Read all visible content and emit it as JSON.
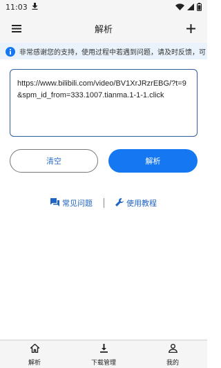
{
  "status_bar": {
    "time": "11:03"
  },
  "app_bar": {
    "title": "解析"
  },
  "notice": {
    "text": "非常感谢您的支持，使用过程中若遇到问题，请及时反馈，可"
  },
  "url_input": {
    "value": "https://www.bilibili.com/video/BV1XrJRzrEBG/?t=9&spm_id_from=333.1007.tianma.1-1-1.click"
  },
  "buttons": {
    "clear_label": "清空",
    "parse_label": "解析"
  },
  "links": {
    "faq_label": "常见问题",
    "tutorial_label": "使用教程"
  },
  "bottom_nav": {
    "items": [
      {
        "label": "解析",
        "icon": "home-icon"
      },
      {
        "label": "下载管理",
        "icon": "download-icon"
      },
      {
        "label": "我的",
        "icon": "person-icon"
      }
    ]
  },
  "colors": {
    "accent": "#1677f2",
    "link": "#1f63c4",
    "notice_bg": "#eaf3fb"
  }
}
